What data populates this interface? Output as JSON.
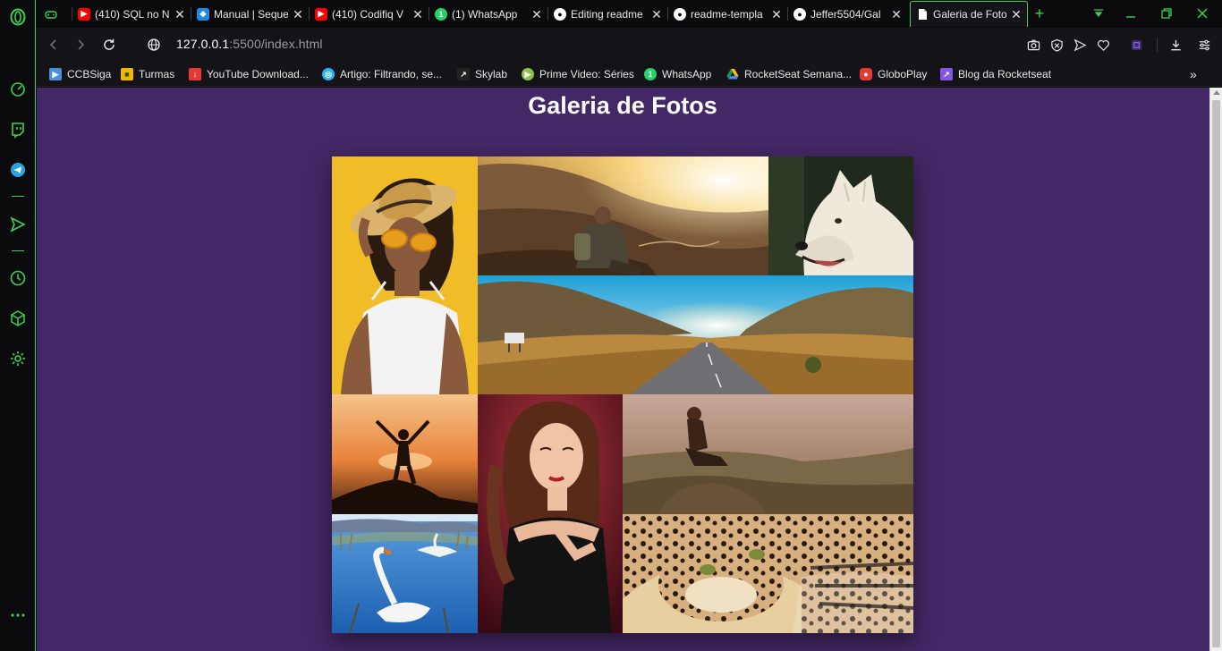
{
  "browser": {
    "tabs": [
      {
        "title": "",
        "icon": "gamepad-icon",
        "color": "#39d353"
      },
      {
        "title": "(410) SQL no N",
        "icon": "youtube-icon",
        "color": "#ff0000"
      },
      {
        "title": "Manual | Seque",
        "icon": "cube-icon",
        "color": "#1e88e5"
      },
      {
        "title": "(410) Codifiq V",
        "icon": "youtube-icon",
        "color": "#ff0000"
      },
      {
        "title": "(1) WhatsApp",
        "icon": "whatsapp-icon",
        "color": "#25d366"
      },
      {
        "title": "Editing readme",
        "icon": "github-icon",
        "color": "#ffffff"
      },
      {
        "title": "readme-templa",
        "icon": "github-icon",
        "color": "#ffffff"
      },
      {
        "title": "Jeffer5504/Gal",
        "icon": "github-icon",
        "color": "#ffffff"
      },
      {
        "title": "Galeria de Foto",
        "icon": "page-icon",
        "color": "#ffffff",
        "active": true
      }
    ],
    "new_tab_symbol": "+",
    "close_symbol": "✕",
    "address": {
      "host": "127.0.0.1",
      "path": ":5500/index.html"
    },
    "bookmarks": [
      {
        "label": "CCBSiga",
        "icon": "ccbsiga-icon",
        "color": "#4a90d9"
      },
      {
        "label": "Turmas",
        "icon": "classroom-icon",
        "color": "#f4b400"
      },
      {
        "label": "YouTube Download...",
        "icon": "download-icon",
        "color": "#e53935"
      },
      {
        "label": "Artigo: Filtrando, se...",
        "icon": "globe-icon",
        "color": "#29b6f6"
      },
      {
        "label": "Skylab",
        "icon": "skylab-icon",
        "color": "#222222"
      },
      {
        "label": "Prime Video: Séries",
        "icon": "play-icon",
        "color": "#8bc34a"
      },
      {
        "label": "WhatsApp",
        "icon": "whatsapp-icon",
        "color": "#25d366"
      },
      {
        "label": "RocketSeat Semana...",
        "icon": "drive-icon",
        "color": "#fbbc04"
      },
      {
        "label": "GloboPlay",
        "icon": "globoplay-icon",
        "color": "#e53935"
      },
      {
        "label": "Blog da Rocketseat",
        "icon": "rocketseat-icon",
        "color": "#8257e5"
      }
    ],
    "bookmarks_overflow": "»",
    "accent_color": "#39d353"
  },
  "page": {
    "title": "Galeria de Fotos",
    "background_color": "#432865",
    "photos": [
      {
        "subject": "woman-straw-hat",
        "alt": "Mulher com chapéu de palha"
      },
      {
        "subject": "hiker-mountains",
        "alt": "Viajante nas montanhas"
      },
      {
        "subject": "white-wolf",
        "alt": "Lobo branco"
      },
      {
        "subject": "mountain-road",
        "alt": "Estrada entre montanhas"
      },
      {
        "subject": "sunset-silhouette",
        "alt": "Silhueta no pôr do sol"
      },
      {
        "subject": "woman-portrait",
        "alt": "Retrato de mulher"
      },
      {
        "subject": "woman-sitting-hill",
        "alt": "Mulher sentada na colina"
      },
      {
        "subject": "swan-lake",
        "alt": "Cisnes no lago"
      },
      {
        "subject": "leopard",
        "alt": "Leopardo deitado"
      }
    ]
  }
}
